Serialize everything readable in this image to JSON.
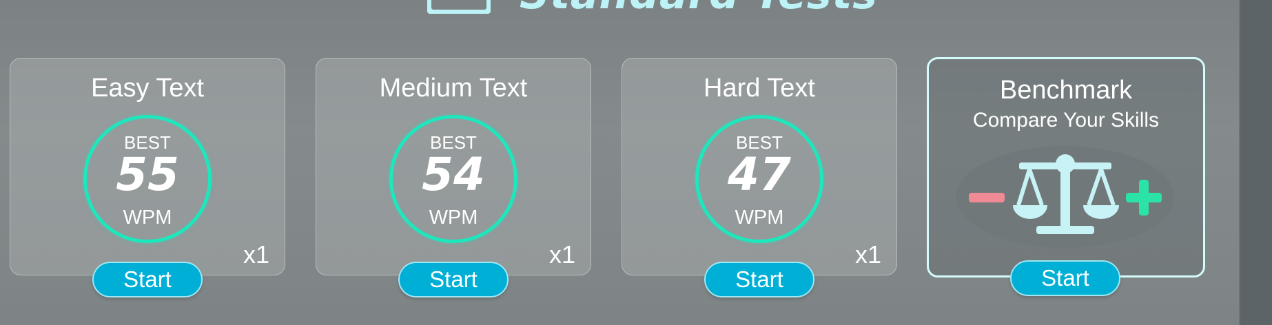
{
  "section": {
    "title": "Standard Tests",
    "icon": "keyboard-icon"
  },
  "tests": [
    {
      "title": "Easy Text",
      "best_label": "BEST",
      "best_value": "55",
      "unit": "WPM",
      "multiplier": "x1",
      "start_label": "Start"
    },
    {
      "title": "Medium Text",
      "best_label": "BEST",
      "best_value": "54",
      "unit": "WPM",
      "multiplier": "x1",
      "start_label": "Start"
    },
    {
      "title": "Hard Text",
      "best_label": "BEST",
      "best_value": "47",
      "unit": "WPM",
      "multiplier": "x1",
      "start_label": "Start"
    }
  ],
  "benchmark": {
    "title": "Benchmark",
    "subtitle": "Compare Your Skills",
    "icon": "balance-scale-icon",
    "start_label": "Start"
  },
  "colors": {
    "accent_ring": "#1de7bd",
    "button": "#00afd6",
    "title": "#bdf3f6",
    "minus": "#f08a95",
    "plus": "#2be3a6"
  }
}
